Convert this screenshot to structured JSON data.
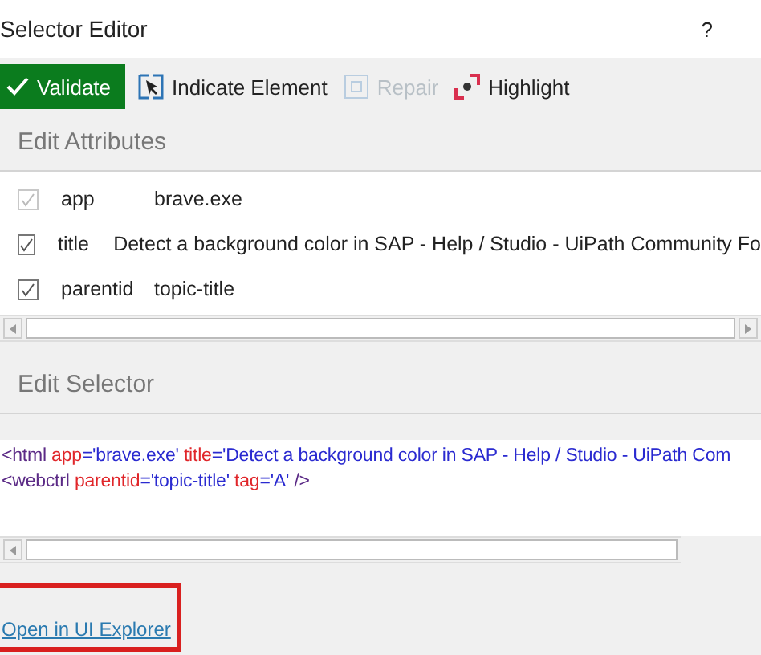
{
  "window": {
    "title": "Selector Editor",
    "help": "?"
  },
  "toolbar": [
    {
      "kind": "validate",
      "label": "Validate",
      "disabled": false
    },
    {
      "kind": "indicate",
      "label": "Indicate Element",
      "disabled": false
    },
    {
      "kind": "repair",
      "label": "Repair",
      "disabled": true
    },
    {
      "kind": "highlight",
      "label": "Highlight",
      "disabled": false
    }
  ],
  "attributes": {
    "heading": "Edit Attributes",
    "rows": [
      {
        "name": "app",
        "value": "brave.exe",
        "checked": true,
        "disabled": true
      },
      {
        "name": "title",
        "value": "Detect a background color in SAP - Help / Studio - UiPath Community Fo",
        "checked": true,
        "disabled": false
      },
      {
        "name": "parentid",
        "value": "topic-title",
        "checked": true,
        "disabled": false
      }
    ]
  },
  "selector": {
    "heading": "Edit Selector",
    "lines": [
      [
        {
          "kind": "tag",
          "text": "<html "
        },
        {
          "kind": "attr",
          "text": "app"
        },
        {
          "kind": "value",
          "text": "='brave.exe' "
        },
        {
          "kind": "attr",
          "text": "title"
        },
        {
          "kind": "value",
          "text": "='Detect a background color in SAP - Help / Studio - UiPath Com"
        }
      ],
      [
        {
          "kind": "tag",
          "text": "<webctrl "
        },
        {
          "kind": "attr",
          "text": "parentid"
        },
        {
          "kind": "value",
          "text": "='topic-title' "
        },
        {
          "kind": "attr",
          "text": "tag"
        },
        {
          "kind": "value",
          "text": "='A' "
        },
        {
          "kind": "tag",
          "text": "/>"
        }
      ]
    ]
  },
  "link": {
    "label": "Open in UI Explorer",
    "highlighted": true
  }
}
